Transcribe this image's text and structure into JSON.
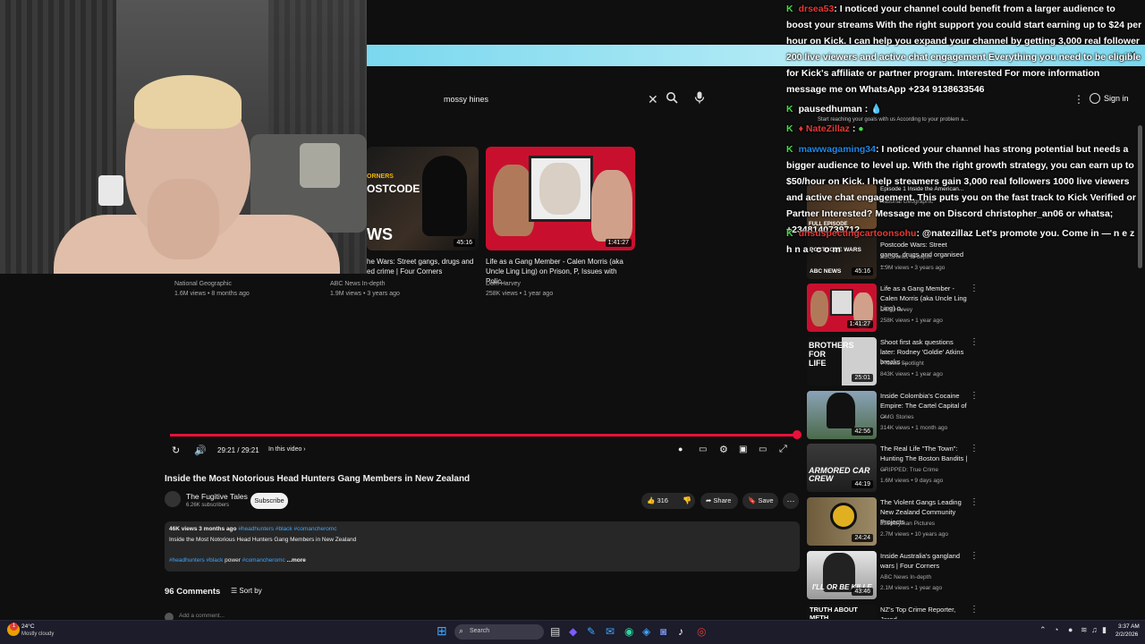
{
  "search": {
    "query": "mossy hines"
  },
  "header": {
    "signin_label": "Sign in"
  },
  "top_videos": [
    {
      "title_line1": "he Wars: Street gangs, drugs and",
      "title_line2": "ed crime | Four Corners",
      "channel": "ABC News In-depth",
      "meta": "1.9M views • 3 years ago",
      "duration": "45:16",
      "thumb_text1": "ORNERS",
      "thumb_text2": "OSTCODE",
      "thumb_text3": "WS"
    },
    {
      "title_line1": "Life as a Gang Member - Calen Morris (aka",
      "title_line2": "Uncle Ling Ling) on Prison, P, Issues with Polic...",
      "channel": "Dom Harvey",
      "meta": "258K views • 1 year ago",
      "duration": "1:41:27"
    }
  ],
  "left_partial": {
    "channel": "National Geographic",
    "meta": "1.6M views • 8 months ago"
  },
  "player": {
    "time": "29:21 / 29:21",
    "in_video": "In this video ›"
  },
  "video": {
    "title": "Inside the Most Notorious Head Hunters Gang Members in New Zealand",
    "channel": "The Fugitive Tales",
    "subscribers": "6.26K subscribers",
    "subscribe_label": "Subscribe",
    "likes": "316",
    "share_label": "Share",
    "save_label": "Save",
    "desc_meta": "46K views  3 months ago",
    "desc_tags_top": "#headhunters #black #comancheromc",
    "desc_line": "Inside the Most Notorious Head Hunters Gang Members in New Zealand",
    "desc_tags_bottom_a": "#headhunters #black",
    "desc_tags_bottom_b": "power",
    "desc_tags_bottom_c": "#comancheromc",
    "more_label": "...more",
    "comments_count": "96 Comments",
    "sort_label": "Sort by",
    "add_comment": "Add a comment..."
  },
  "chat": [
    {
      "user": "drsea53",
      "sep": ":",
      "text": "I noticed your channel could benefit from a larger audience to boost your streams With the right support you could start earning up to $24 per hour on Kick. I can help you expand your channel by getting 3,000 real follower 200 live viewers and active chat engagement Everything you need to be eligible for Kick's affiliate or partner program. Interested For more information message me on WhatsApp +234 9138633546"
    },
    {
      "user": "pausedhuman",
      "sep": ":",
      "text": ""
    },
    {
      "user": "NateZillaz",
      "sep": ":",
      "text": ""
    },
    {
      "user": "mawwagaming34",
      "sep": ":",
      "text": "I noticed your channel has strong potential but needs a bigger audience to level up. With the right growth strategy, you can earn up to $50/hour on Kick. I help streamers gain 3,000 real followers 1000 live viewers and active chat engagement. This puts you on the fast track to Kick Verified or Partner Interested? Message me on Discord christopher_an06 or whatsa; +2348140739712"
    },
    {
      "user": "unsuspectingcartoonsohu",
      "sep": ":",
      "text": "@natezillaz Let's promote you. Come in — n e z h n a . c o m"
    }
  ],
  "overlay_popup": "Start reaching your goals with us According to your problem a...",
  "sidebar_videos": [
    {
      "title": "Episode 1 Inside the American...",
      "channel": "National Geographic",
      "meta": "",
      "duration": ""
    },
    {
      "title": "Postcode Wars: Street gangs, drugs and organised ...",
      "channel": "ABC News In-depth",
      "meta": "1.9M views • 3 years ago",
      "duration": "45:16"
    },
    {
      "title": "Life as a Gang Member - Calen Morris (aka Uncle Ling Ling) o...",
      "channel": "Dom Harvey",
      "meta": "258K views • 1 year ago",
      "duration": "1:41:27"
    },
    {
      "title": "Shoot first ask questions later: Rodney 'Goldie' Atkins breaks ...",
      "channel": "7 News Spotlight",
      "meta": "843K views • 1 year ago",
      "duration": "25:01"
    },
    {
      "title": "Inside Colombia's Cocaine Empire: The Cartel Capital of ...",
      "channel": "OMG Stories",
      "meta": "314K views • 1 month ago",
      "duration": "42:56"
    },
    {
      "title": "The Real Life \"The Town\": Hunting The Boston Bandits | ...",
      "channel": "GRIPPED: True Crime",
      "meta": "1.6M views • 9 days ago",
      "duration": "44:19"
    },
    {
      "title": "The Violent Gangs Leading New Zealand Community Projects",
      "channel": "Journeyman Pictures",
      "meta": "2.7M views • 10 years ago",
      "duration": "24:24"
    },
    {
      "title": "Inside Australia's gangland wars | Four Corners",
      "channel": "ABC News In-depth",
      "meta": "2.1M views • 1 year ago",
      "duration": "43:46"
    },
    {
      "title": "NZ's Top Crime Reporter, Jared",
      "channel": "",
      "meta": "",
      "duration": ""
    }
  ],
  "thumb_labels": {
    "brothers": "BROTHERS FOR LIFE",
    "armored": "ARMORED CAR CREW",
    "killed": "I'LL OR BE KILLE",
    "meth": "TRUTH ABOUT METH",
    "postcode": "POSTCODE WARS",
    "full_episode": "FULL EPISODE",
    "abc": "ABC NEWS"
  },
  "taskbar": {
    "weather_temp": "24°C",
    "weather_desc": "Mostly cloudy",
    "search_placeholder": "Search",
    "time": "3:37 AM",
    "date": "2/2/2026",
    "weather_badge": "1"
  }
}
